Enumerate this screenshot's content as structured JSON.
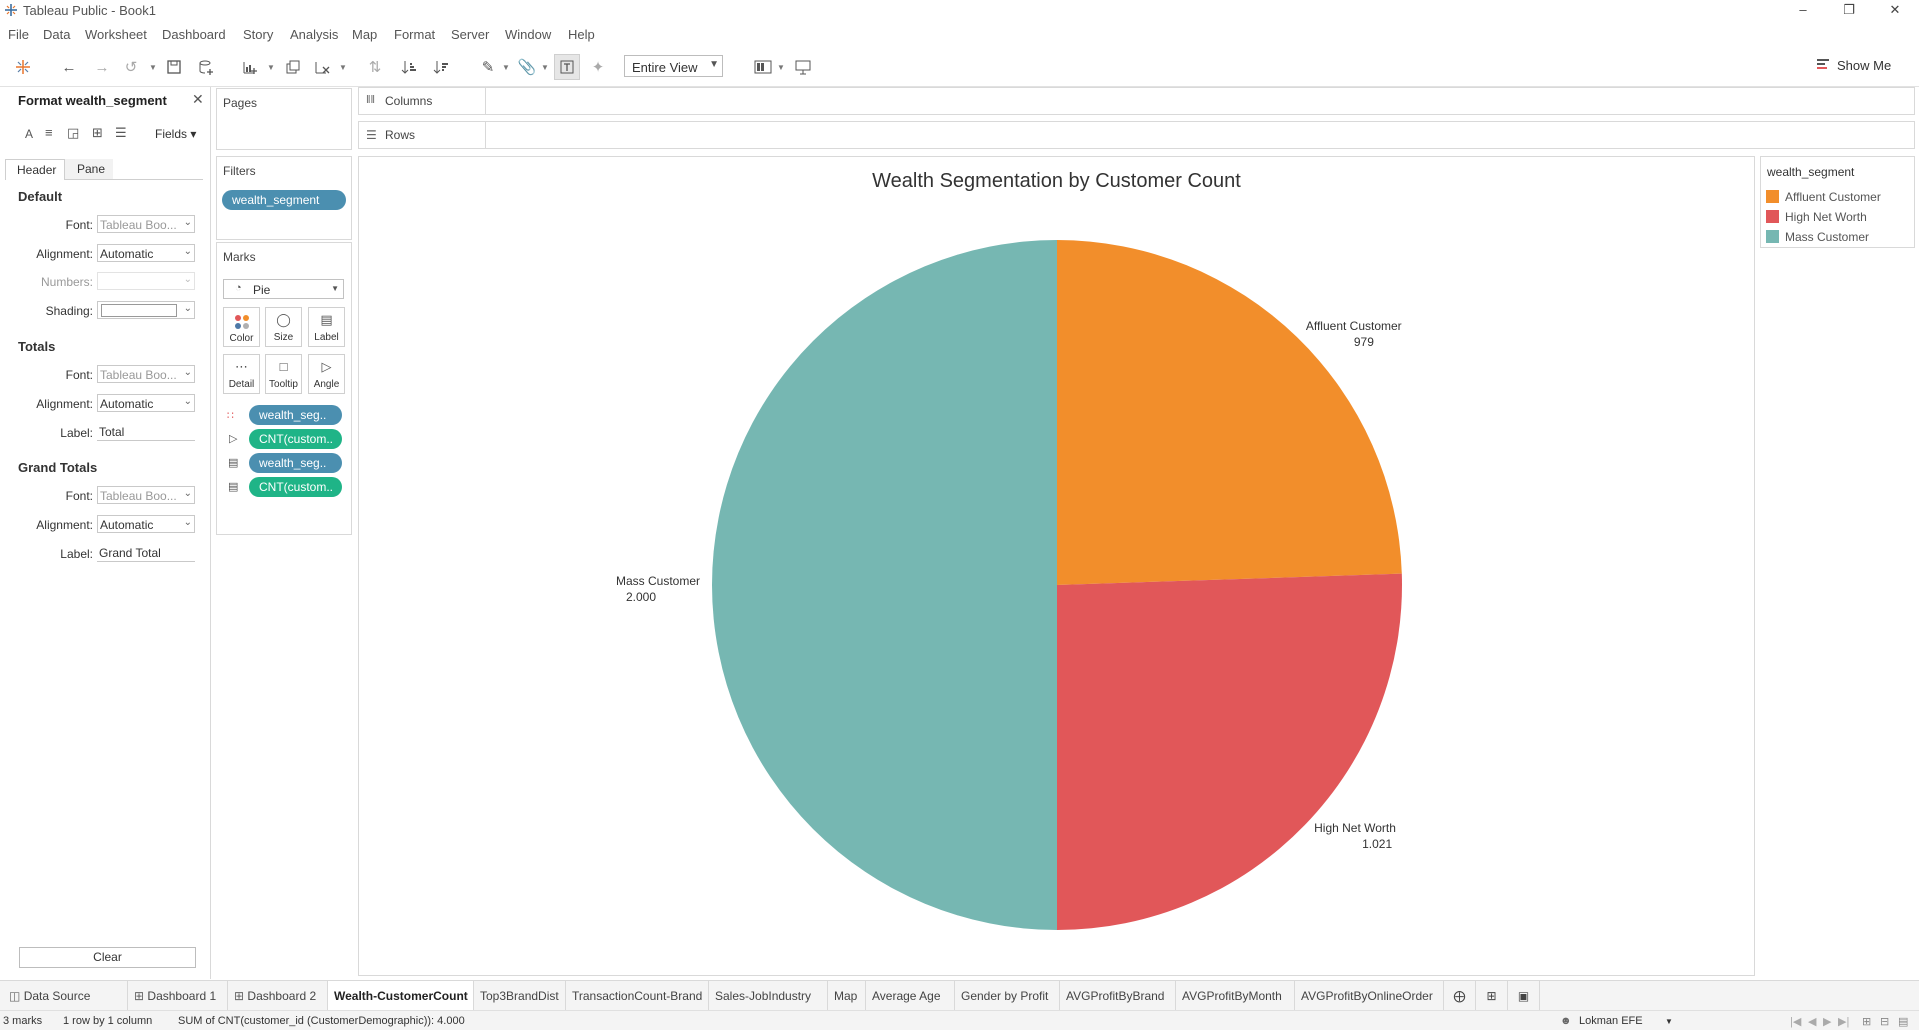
{
  "window": {
    "title": "Tableau Public - Book1"
  },
  "menu": [
    "File",
    "Data",
    "Worksheet",
    "Dashboard",
    "Story",
    "Analysis",
    "Map",
    "Format",
    "Server",
    "Window",
    "Help"
  ],
  "toolbar": {
    "view_mode": "Entire View",
    "show_me": "Show Me"
  },
  "format_pane": {
    "title": "Format wealth_segment",
    "fields_label": "Fields",
    "tabs": [
      "Header",
      "Pane"
    ],
    "default": {
      "heading": "Default",
      "font_label": "Font:",
      "font_value": "Tableau Boo...",
      "alignment_label": "Alignment:",
      "alignment_value": "Automatic",
      "numbers_label": "Numbers:",
      "shading_label": "Shading:"
    },
    "totals": {
      "heading": "Totals",
      "font_label": "Font:",
      "font_value": "Tableau Boo...",
      "alignment_label": "Alignment:",
      "alignment_value": "Automatic",
      "label_label": "Label:",
      "label_value": "Total"
    },
    "grand_totals": {
      "heading": "Grand Totals",
      "font_label": "Font:",
      "font_value": "Tableau Boo...",
      "alignment_label": "Alignment:",
      "alignment_value": "Automatic",
      "label_label": "Label:",
      "label_value": "Grand Total"
    },
    "clear_button": "Clear"
  },
  "cards": {
    "pages": "Pages",
    "filters": {
      "title": "Filters",
      "pill": "wealth_segment"
    },
    "marks": {
      "title": "Marks",
      "type": "Pie",
      "buttons": [
        "Color",
        "Size",
        "Label",
        "Detail",
        "Tooltip",
        "Angle"
      ],
      "fields": [
        "wealth_seg..",
        "CNT(custom..",
        "wealth_seg..",
        "CNT(custom.."
      ]
    }
  },
  "shelves": {
    "columns": "Columns",
    "rows": "Rows"
  },
  "legend": {
    "title": "wealth_segment",
    "items": [
      {
        "label": "Affluent Customer",
        "color": "#f28e2b"
      },
      {
        "label": "High Net Worth",
        "color": "#e15759"
      },
      {
        "label": "Mass Customer",
        "color": "#76b7b2"
      }
    ]
  },
  "chart_data": {
    "type": "pie",
    "title": "Wealth Segmentation by Customer Count",
    "categories": [
      "Affluent Customer",
      "High Net Worth",
      "Mass Customer"
    ],
    "values": [
      979,
      1021,
      2000
    ],
    "value_labels": [
      "979",
      "1.021",
      "2.000"
    ],
    "colors": [
      "#f28e2b",
      "#e15759",
      "#76b7b2"
    ],
    "start": "12 o'clock",
    "direction": "clockwise"
  },
  "tabs": [
    "Data Source",
    "Dashboard 1",
    "Dashboard 2",
    "Wealth-CustomerCount",
    "Top3BrandDist",
    "TransactionCount-Brand",
    "Sales-JobIndustry",
    "Map",
    "Average Age",
    "Gender by Profit",
    "AVGProfitByBrand",
    "AVGProfitByMonth",
    "AVGProfitByOnlineOrder"
  ],
  "active_tab": "Wealth-CustomerCount",
  "status": {
    "marks": "3 marks",
    "rows": "1 row by 1 column",
    "sum": "SUM of CNT(customer_id (CustomerDemographic)): 4.000",
    "user": "Lokman EFE"
  }
}
